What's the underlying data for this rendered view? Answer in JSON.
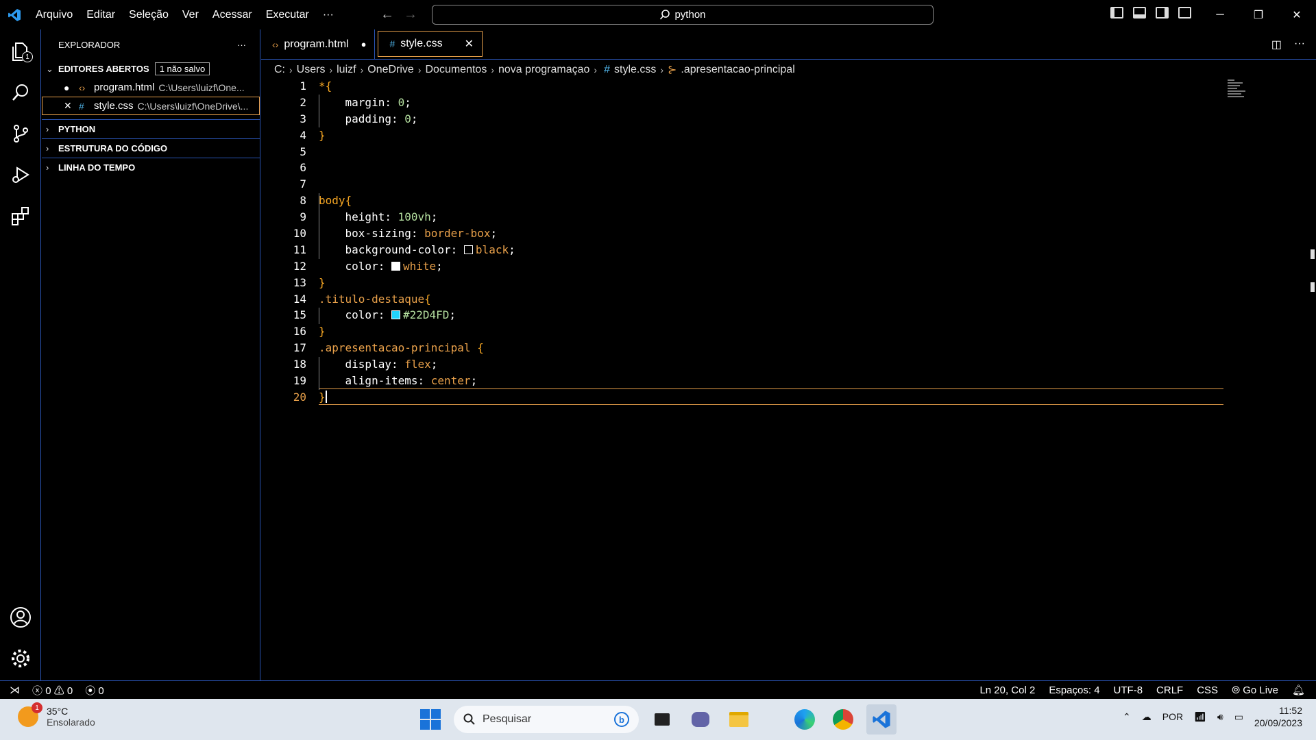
{
  "menu": [
    "Arquivo",
    "Editar",
    "Seleção",
    "Ver",
    "Acessar",
    "Executar"
  ],
  "search": {
    "text": "python"
  },
  "activity": {
    "explorer_badge": "1"
  },
  "sidebar": {
    "title": "EXPLORADOR",
    "open_editors": {
      "label": "EDITORES ABERTOS",
      "unsaved": "1 não salvo",
      "items": [
        {
          "name": "program.html",
          "path": "C:\\Users\\luizf\\One..."
        },
        {
          "name": "style.css",
          "path": "C:\\Users\\luizf\\OneDrive\\..."
        }
      ]
    },
    "sections": [
      "PYTHON",
      "ESTRUTURA DO CÓDIGO",
      "LINHA DO TEMPO"
    ]
  },
  "tabs": [
    {
      "label": "program.html",
      "icon": "html-icon"
    },
    {
      "label": "style.css",
      "icon": "css-hash-icon"
    }
  ],
  "breadcrumb": [
    "C:",
    "Users",
    "luizf",
    "OneDrive",
    "Documentos",
    "nova programaçao",
    "style.css",
    ".apresentacao-principal"
  ],
  "editor": {
    "current_line": 20,
    "lines": [
      [
        [
          "*",
          "sel-c"
        ],
        [
          "{",
          "brace"
        ]
      ],
      [
        [
          "    margin",
          "prop"
        ],
        [
          ": ",
          "punc"
        ],
        [
          "0",
          "num"
        ],
        [
          ";",
          "punc"
        ]
      ],
      [
        [
          "    padding",
          "prop"
        ],
        [
          ": ",
          "punc"
        ],
        [
          "0",
          "num"
        ],
        [
          ";",
          "punc"
        ]
      ],
      [
        [
          "}",
          "brace"
        ]
      ],
      [],
      [],
      [],
      [
        [
          "body",
          "sel-c"
        ],
        [
          "{",
          "brace"
        ]
      ],
      [
        [
          "    height",
          "prop"
        ],
        [
          ": ",
          "punc"
        ],
        [
          "100vh",
          "num"
        ],
        [
          ";",
          "punc"
        ]
      ],
      [
        [
          "    box-sizing",
          "prop"
        ],
        [
          ": ",
          "punc"
        ],
        [
          "border-box",
          "val"
        ],
        [
          ";",
          "punc"
        ]
      ],
      [
        [
          "    background-color",
          "prop"
        ],
        [
          ": ",
          "punc"
        ],
        [
          "#000000",
          "swatch"
        ],
        [
          "black",
          "val"
        ],
        [
          ";",
          "punc"
        ]
      ],
      [
        [
          "    color",
          "prop"
        ],
        [
          ": ",
          "punc"
        ],
        [
          "#ffffff",
          "swatch"
        ],
        [
          "white",
          "val"
        ],
        [
          ";",
          "punc"
        ]
      ],
      [
        [
          "}",
          "brace"
        ]
      ],
      [
        [
          ".titulo-destaque",
          "cls"
        ],
        [
          "{",
          "brace"
        ]
      ],
      [
        [
          "    color",
          "prop"
        ],
        [
          ": ",
          "punc"
        ],
        [
          "#22D4FD",
          "swatch"
        ],
        [
          "#22D4FD",
          "num"
        ],
        [
          ";",
          "punc"
        ]
      ],
      [
        [
          "}",
          "brace"
        ]
      ],
      [
        [
          ".apresentacao-principal ",
          "cls"
        ],
        [
          "{",
          "brace"
        ]
      ],
      [
        [
          "    display",
          "prop"
        ],
        [
          ": ",
          "punc"
        ],
        [
          "flex",
          "val"
        ],
        [
          ";",
          "punc"
        ]
      ],
      [
        [
          "    align-items",
          "prop"
        ],
        [
          ": ",
          "punc"
        ],
        [
          "center",
          "val"
        ],
        [
          ";",
          "punc"
        ]
      ],
      [
        [
          "}",
          "brace"
        ]
      ]
    ]
  },
  "status": {
    "errors": "0",
    "warnings": "0",
    "ports": "0",
    "position": "Ln 20, Col 2",
    "spaces": "Espaços: 4",
    "encoding": "UTF-8",
    "eol": "CRLF",
    "language": "CSS",
    "golive": "Go Live"
  },
  "taskbar": {
    "temperature": "35°C",
    "weather": "Ensolarado",
    "weather_badge": "1",
    "search_placeholder": "Pesquisar",
    "lang": "POR",
    "time": "11:52",
    "date": "20/09/2023"
  },
  "colors": {
    "accent": "#e8a04a",
    "border": "#2a55b5",
    "selector": "#f5a623",
    "cyan_swatch": "#22D4FD"
  }
}
